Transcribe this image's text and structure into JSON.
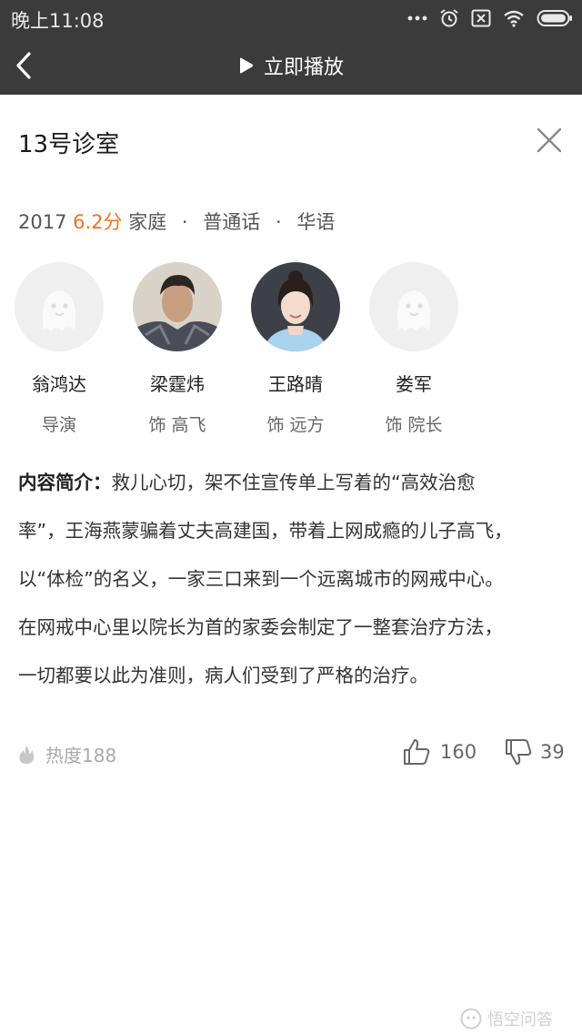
{
  "status_bar": {
    "time": "晚上11:08"
  },
  "nav": {
    "play_label": "立即播放"
  },
  "movie": {
    "title": "13号诊室",
    "year": "2017",
    "score": "6.2分",
    "genre": "家庭",
    "language": "普通话",
    "region": "华语"
  },
  "cast": [
    {
      "name": "翁鸿达",
      "role": "导演"
    },
    {
      "name": "梁霆炜",
      "role": "饰 高飞"
    },
    {
      "name": "王路晴",
      "role": "饰 远方"
    },
    {
      "name": "娄军",
      "role": "饰 院长"
    }
  ],
  "intro": {
    "label": "内容简介：",
    "lines": [
      "救儿心切，架不住宣传单上写着的“高效治愈",
      "率”，王海燕蒙骗着丈夫高建国，带着上网成瘾的儿子高飞，",
      "以“体检”的名义，一家三口来到一个远离城市的网戒中心。",
      "在网戒中心里以院长为首的家委会制定了一整套治疗方法，",
      "一切都要以此为准则，病人们受到了严格的治疗。"
    ]
  },
  "stats": {
    "heat": "热度188",
    "likes": "160",
    "dislikes": "39"
  },
  "watermark": "悟空问答",
  "colors": {
    "topbar": "#3b3b3b",
    "score": "#f7701e"
  }
}
